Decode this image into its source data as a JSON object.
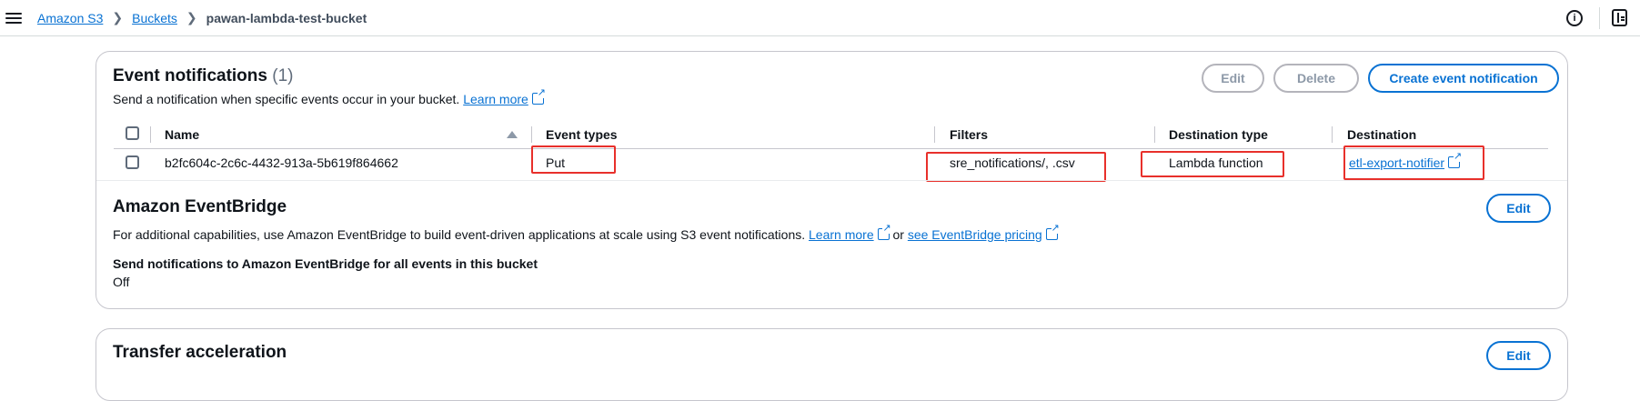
{
  "breadcrumb": {
    "items": [
      "Amazon S3",
      "Buckets"
    ],
    "current": "pawan-lambda-test-bucket"
  },
  "event_notifications": {
    "title": "Event notifications",
    "count": "(1)",
    "description": "Send a notification when specific events occur in your bucket.",
    "learn_more": "Learn more",
    "buttons": {
      "edit": "Edit",
      "delete": "Delete",
      "create": "Create event notification"
    },
    "columns": [
      "Name",
      "Event types",
      "Filters",
      "Destination type",
      "Destination"
    ],
    "rows": [
      {
        "name": "b2fc604c-2c6c-4432-913a-5b619f864662",
        "event_types": "Put",
        "filters": "sre_notifications/, .csv",
        "destination_type": "Lambda function",
        "destination": "etl-export-notifier"
      }
    ]
  },
  "eventbridge": {
    "title": "Amazon EventBridge",
    "edit": "Edit",
    "description": "For additional capabilities, use Amazon EventBridge to build event-driven applications at scale using S3 event notifications.",
    "learn_more": "Learn more",
    "or": "or",
    "pricing_link": "see EventBridge pricing",
    "setting_label": "Send notifications to Amazon EventBridge for all events in this bucket",
    "setting_value": "Off"
  },
  "transfer_acceleration": {
    "title": "Transfer acceleration",
    "edit": "Edit"
  },
  "colors": {
    "link": "#0972d3",
    "highlight": "#e8302b",
    "border": "#c6c6cd"
  }
}
